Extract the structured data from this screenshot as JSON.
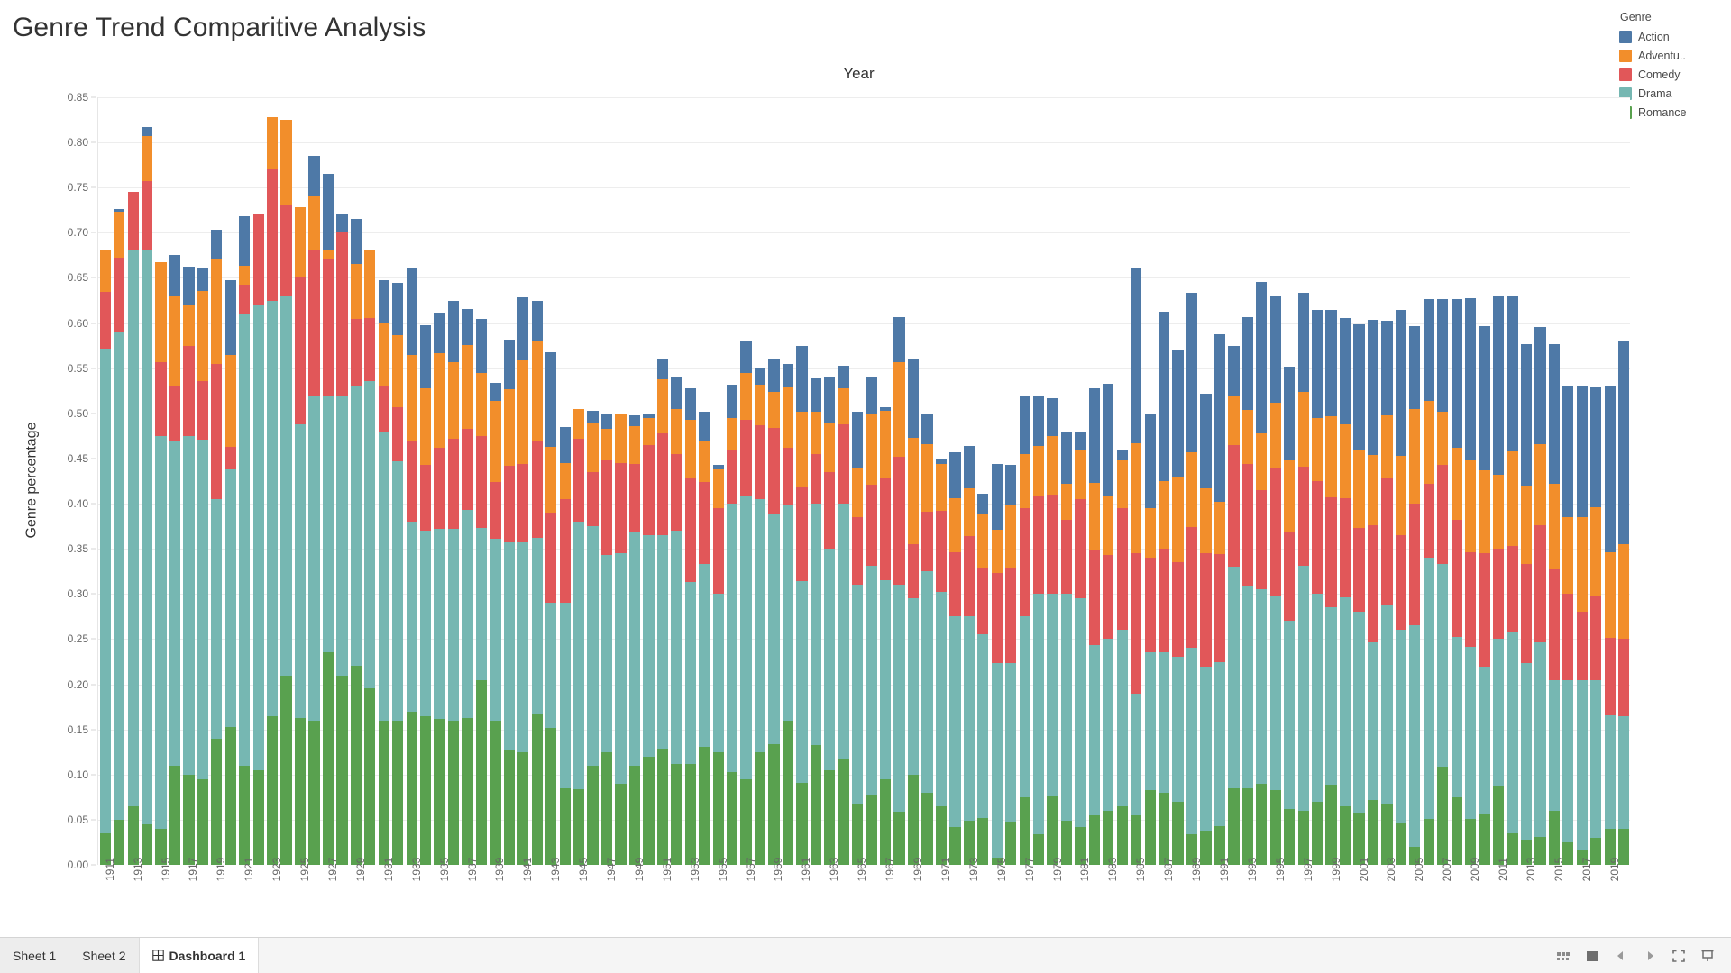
{
  "dashboard": {
    "title": "Genre Trend Comparitive Analysis",
    "chart_header": "Year",
    "y_axis_title": "Genre percentage"
  },
  "legend": {
    "title": "Genre",
    "items": [
      {
        "label": "Action",
        "color": "#4e79a7"
      },
      {
        "label": "Adventu..",
        "color": "#f28e2b"
      },
      {
        "label": "Comedy",
        "color": "#e15759"
      },
      {
        "label": "Drama",
        "color": "#76b7b2"
      },
      {
        "label": "Romance",
        "color": "#59a14f"
      }
    ]
  },
  "statusbar": {
    "tabs": [
      {
        "label": "Sheet 1",
        "active": false,
        "icon": ""
      },
      {
        "label": "Sheet 2",
        "active": false,
        "icon": ""
      },
      {
        "label": "Dashboard 1",
        "active": true,
        "icon": "grid-icon"
      }
    ],
    "icons": [
      "filmstrip-icon",
      "square-icon",
      "previous-arrow-icon",
      "next-arrow-icon",
      "fullscreen-icon",
      "presentation-icon"
    ]
  },
  "chart_data": {
    "type": "bar",
    "stacked": true,
    "title": "Genre Trend Comparitive Analysis",
    "subtitle": "Year",
    "xlabel": "Year",
    "ylabel": "Genre percentage",
    "ylim": [
      0.0,
      0.85
    ],
    "ytick_step": 0.05,
    "yticks": [
      "0.00",
      "0.05",
      "0.10",
      "0.15",
      "0.20",
      "0.25",
      "0.30",
      "0.35",
      "0.40",
      "0.45",
      "0.50",
      "0.55",
      "0.60",
      "0.65",
      "0.70",
      "0.75",
      "0.80",
      "0.85"
    ],
    "grid": true,
    "legend_position": "top-right",
    "xtick_every": 2,
    "xtick_labels": [
      "1911",
      "1913",
      "1915",
      "1917",
      "1919",
      "1921",
      "1923",
      "1925",
      "1927",
      "1929",
      "1931",
      "1933",
      "1935",
      "1937",
      "1939",
      "1941",
      "1943",
      "1945",
      "1947",
      "1949",
      "1951",
      "1953",
      "1955",
      "1957",
      "1959",
      "1961",
      "1963",
      "1965",
      "1967",
      "1969",
      "1971",
      "1973",
      "1975",
      "1977",
      "1979",
      "1981",
      "1983",
      "1985",
      "1987",
      "1989",
      "1991",
      "1993",
      "1995",
      "1997",
      "1999",
      "2001",
      "2003",
      "2005",
      "2007",
      "2009",
      "2011",
      "2013",
      "2015",
      "2017",
      "2019"
    ],
    "series_order_bottom_to_top": [
      "Romance",
      "Drama",
      "Comedy",
      "Adventure",
      "Action"
    ],
    "categories": [
      1911,
      1912,
      1913,
      1914,
      1915,
      1916,
      1917,
      1918,
      1919,
      1920,
      1921,
      1922,
      1923,
      1924,
      1925,
      1926,
      1927,
      1928,
      1929,
      1930,
      1931,
      1932,
      1933,
      1934,
      1935,
      1936,
      1937,
      1938,
      1939,
      1940,
      1941,
      1942,
      1943,
      1944,
      1945,
      1946,
      1947,
      1948,
      1949,
      1950,
      1951,
      1952,
      1953,
      1954,
      1955,
      1956,
      1957,
      1958,
      1959,
      1960,
      1961,
      1962,
      1963,
      1964,
      1965,
      1966,
      1967,
      1968,
      1969,
      1970,
      1971,
      1972,
      1973,
      1974,
      1975,
      1976,
      1977,
      1978,
      1979,
      1980,
      1981,
      1982,
      1983,
      1984,
      1985,
      1986,
      1987,
      1988,
      1989,
      1990,
      1991,
      1992,
      1993,
      1994,
      1995,
      1996,
      1997,
      1998,
      1999,
      2000,
      2001,
      2002,
      2003,
      2004,
      2005,
      2006,
      2007,
      2008,
      2009,
      2010,
      2011,
      2012,
      2013,
      2014,
      2015,
      2016,
      2017,
      2018,
      2019,
      2020
    ],
    "series": [
      {
        "name": "Romance",
        "color": "#59a14f",
        "values": [
          0.035,
          0.05,
          0.065,
          0.045,
          0.04,
          0.11,
          0.1,
          0.095,
          0.14,
          0.153,
          0.11,
          0.105,
          0.165,
          0.21,
          0.163,
          0.16,
          0.235,
          0.21,
          0.22,
          0.196,
          0.16,
          0.16,
          0.17,
          0.165,
          0.162,
          0.16,
          0.163,
          0.205,
          0.16,
          0.128,
          0.125,
          0.168,
          0.152,
          0.085,
          0.084,
          0.11,
          0.125,
          0.09,
          0.11,
          0.12,
          0.129,
          0.112,
          0.112,
          0.131,
          0.125,
          0.103,
          0.095,
          0.125,
          0.134,
          0.16,
          0.091,
          0.133,
          0.105,
          0.117,
          0.068,
          0.078,
          0.095,
          0.059,
          0.1,
          0.08,
          0.065,
          0.042,
          0.049,
          0.052,
          0.008,
          0.048,
          0.075,
          0.034,
          0.077,
          0.049,
          0.042,
          0.055,
          0.06,
          0.065,
          0.055,
          0.083,
          0.08,
          0.07,
          0.034,
          0.038,
          0.043,
          0.085,
          0.085,
          0.09,
          0.083,
          0.062,
          0.06,
          0.07,
          0.089,
          0.065,
          0.058,
          0.072,
          0.068,
          0.047,
          0.02,
          0.051,
          0.109,
          0.075,
          0.051,
          0.057,
          0.088,
          0.035,
          0.028,
          0.031,
          0.06,
          0.025,
          0.017,
          0.03,
          0.04,
          0.04
        ]
      },
      {
        "name": "Drama",
        "color": "#76b7b2",
        "values": [
          0.537,
          0.54,
          0.615,
          0.635,
          0.435,
          0.36,
          0.375,
          0.376,
          0.265,
          0.285,
          0.5,
          0.515,
          0.46,
          0.42,
          0.325,
          0.36,
          0.285,
          0.31,
          0.31,
          0.34,
          0.32,
          0.287,
          0.21,
          0.205,
          0.21,
          0.212,
          0.23,
          0.168,
          0.201,
          0.229,
          0.232,
          0.194,
          0.138,
          0.205,
          0.296,
          0.265,
          0.218,
          0.255,
          0.259,
          0.245,
          0.236,
          0.258,
          0.201,
          0.202,
          0.175,
          0.297,
          0.313,
          0.28,
          0.255,
          0.238,
          0.223,
          0.267,
          0.245,
          0.283,
          0.242,
          0.253,
          0.22,
          0.251,
          0.195,
          0.245,
          0.237,
          0.233,
          0.226,
          0.203,
          0.215,
          0.175,
          0.2,
          0.266,
          0.223,
          0.251,
          0.253,
          0.188,
          0.19,
          0.195,
          0.135,
          0.152,
          0.155,
          0.16,
          0.206,
          0.182,
          0.181,
          0.245,
          0.224,
          0.215,
          0.215,
          0.208,
          0.271,
          0.23,
          0.196,
          0.231,
          0.222,
          0.174,
          0.22,
          0.213,
          0.245,
          0.289,
          0.224,
          0.177,
          0.19,
          0.163,
          0.162,
          0.223,
          0.195,
          0.215,
          0.145,
          0.18,
          0.188,
          0.175,
          0.126,
          0.125
        ]
      },
      {
        "name": "Comedy",
        "color": "#e15759",
        "values": [
          0.063,
          0.082,
          0.065,
          0.077,
          0.082,
          0.06,
          0.1,
          0.065,
          0.15,
          0.025,
          0.033,
          0.1,
          0.145,
          0.1,
          0.163,
          0.16,
          0.15,
          0.18,
          0.075,
          0.07,
          0.05,
          0.06,
          0.09,
          0.073,
          0.09,
          0.1,
          0.09,
          0.102,
          0.063,
          0.085,
          0.087,
          0.108,
          0.1,
          0.115,
          0.092,
          0.06,
          0.105,
          0.1,
          0.075,
          0.1,
          0.113,
          0.085,
          0.115,
          0.091,
          0.095,
          0.06,
          0.085,
          0.082,
          0.095,
          0.064,
          0.105,
          0.055,
          0.085,
          0.088,
          0.075,
          0.09,
          0.113,
          0.142,
          0.06,
          0.066,
          0.09,
          0.071,
          0.089,
          0.074,
          0.1,
          0.105,
          0.12,
          0.108,
          0.11,
          0.082,
          0.11,
          0.105,
          0.093,
          0.135,
          0.155,
          0.105,
          0.115,
          0.105,
          0.134,
          0.125,
          0.12,
          0.135,
          0.135,
          0.11,
          0.142,
          0.098,
          0.11,
          0.125,
          0.122,
          0.11,
          0.093,
          0.13,
          0.14,
          0.105,
          0.135,
          0.082,
          0.11,
          0.13,
          0.105,
          0.125,
          0.1,
          0.095,
          0.11,
          0.13,
          0.122,
          0.095,
          0.075,
          0.093,
          0.085,
          0.085
        ]
      },
      {
        "name": "Adventure",
        "color": "#f28e2b",
        "values": [
          0.045,
          0.051,
          0.0,
          0.05,
          0.11,
          0.1,
          0.045,
          0.1,
          0.115,
          0.102,
          0.02,
          0.0,
          0.058,
          0.095,
          0.077,
          0.06,
          0.01,
          0.0,
          0.06,
          0.075,
          0.07,
          0.08,
          0.095,
          0.085,
          0.105,
          0.085,
          0.093,
          0.07,
          0.09,
          0.085,
          0.115,
          0.11,
          0.073,
          0.04,
          0.033,
          0.055,
          0.035,
          0.055,
          0.042,
          0.03,
          0.06,
          0.05,
          0.065,
          0.045,
          0.043,
          0.035,
          0.052,
          0.045,
          0.04,
          0.067,
          0.083,
          0.047,
          0.055,
          0.04,
          0.055,
          0.078,
          0.075,
          0.105,
          0.118,
          0.075,
          0.052,
          0.06,
          0.053,
          0.06,
          0.048,
          0.07,
          0.06,
          0.056,
          0.065,
          0.04,
          0.055,
          0.075,
          0.065,
          0.053,
          0.122,
          0.055,
          0.075,
          0.095,
          0.083,
          0.072,
          0.058,
          0.055,
          0.06,
          0.063,
          0.072,
          0.08,
          0.083,
          0.07,
          0.09,
          0.082,
          0.086,
          0.078,
          0.07,
          0.088,
          0.105,
          0.092,
          0.059,
          0.08,
          0.102,
          0.092,
          0.082,
          0.105,
          0.087,
          0.09,
          0.095,
          0.085,
          0.105,
          0.098,
          0.095,
          0.105
        ]
      },
      {
        "name": "Action",
        "color": "#4e79a7",
        "values": [
          0.0,
          0.003,
          0.0,
          0.01,
          0.0,
          0.045,
          0.042,
          0.025,
          0.033,
          0.083,
          0.055,
          0.0,
          0.0,
          0.0,
          0.0,
          0.045,
          0.085,
          0.02,
          0.05,
          0.0,
          0.048,
          0.058,
          0.095,
          0.07,
          0.045,
          0.068,
          0.04,
          0.06,
          0.02,
          0.055,
          0.07,
          0.045,
          0.105,
          0.04,
          0.0,
          0.013,
          0.017,
          0.0,
          0.012,
          0.005,
          0.022,
          0.035,
          0.035,
          0.033,
          0.005,
          0.037,
          0.035,
          0.018,
          0.036,
          0.026,
          0.073,
          0.037,
          0.05,
          0.025,
          0.062,
          0.042,
          0.004,
          0.05,
          0.087,
          0.034,
          0.006,
          0.051,
          0.047,
          0.022,
          0.073,
          0.045,
          0.065,
          0.055,
          0.042,
          0.058,
          0.02,
          0.105,
          0.125,
          0.012,
          0.193,
          0.105,
          0.188,
          0.14,
          0.177,
          0.105,
          0.186,
          0.055,
          0.103,
          0.168,
          0.119,
          0.104,
          0.11,
          0.12,
          0.118,
          0.118,
          0.14,
          0.15,
          0.105,
          0.162,
          0.092,
          0.113,
          0.125,
          0.165,
          0.18,
          0.16,
          0.198,
          0.172,
          0.157,
          0.13,
          0.155,
          0.145,
          0.145,
          0.133,
          0.185,
          0.225
        ]
      }
    ]
  }
}
